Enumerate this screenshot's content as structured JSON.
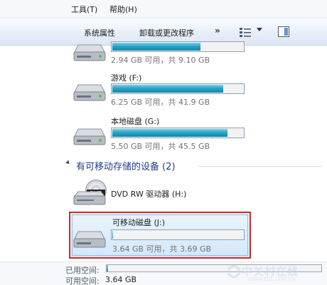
{
  "menubar": {
    "tools": "工具(T)",
    "help": "帮助(H)"
  },
  "toolbar": {
    "system_properties": "系统属性",
    "uninstall": "卸载或更改程序",
    "more": "»"
  },
  "drives": [
    {
      "name": "",
      "info": "2.94 GB 可用，共 9.10 GB",
      "used_fraction": 0.68
    },
    {
      "name": "游戏 (F:)",
      "info": "6.25 GB 可用，共 41.9 GB",
      "used_fraction": 0.85
    },
    {
      "name": "本地磁盘 (G:)",
      "info": "5.50 GB 可用，共 45.5 GB",
      "used_fraction": 0.88
    }
  ],
  "removable_section": {
    "title": "有可移动存储的设备 (2)"
  },
  "dvd": {
    "name": "DVD RW 驱动器 (H:)",
    "badge": "DVD"
  },
  "removable": {
    "name": "可移动磁盘 (J:)",
    "info": "3.64 GB 可用，共 3.69 GB",
    "used_fraction": 0.014
  },
  "details": {
    "used_label": "已用空间:",
    "free_label": "可用空间:",
    "free_value": "3.64 GB",
    "used_fraction": 0.014
  },
  "watermark": {
    "text": "中关村在线",
    "sub": "WWW.ZOL.COM.CN"
  },
  "colors": {
    "accent_bar": "#26a5c8",
    "selection_border": "#d12a2a",
    "section_title": "#1e3c8c"
  }
}
